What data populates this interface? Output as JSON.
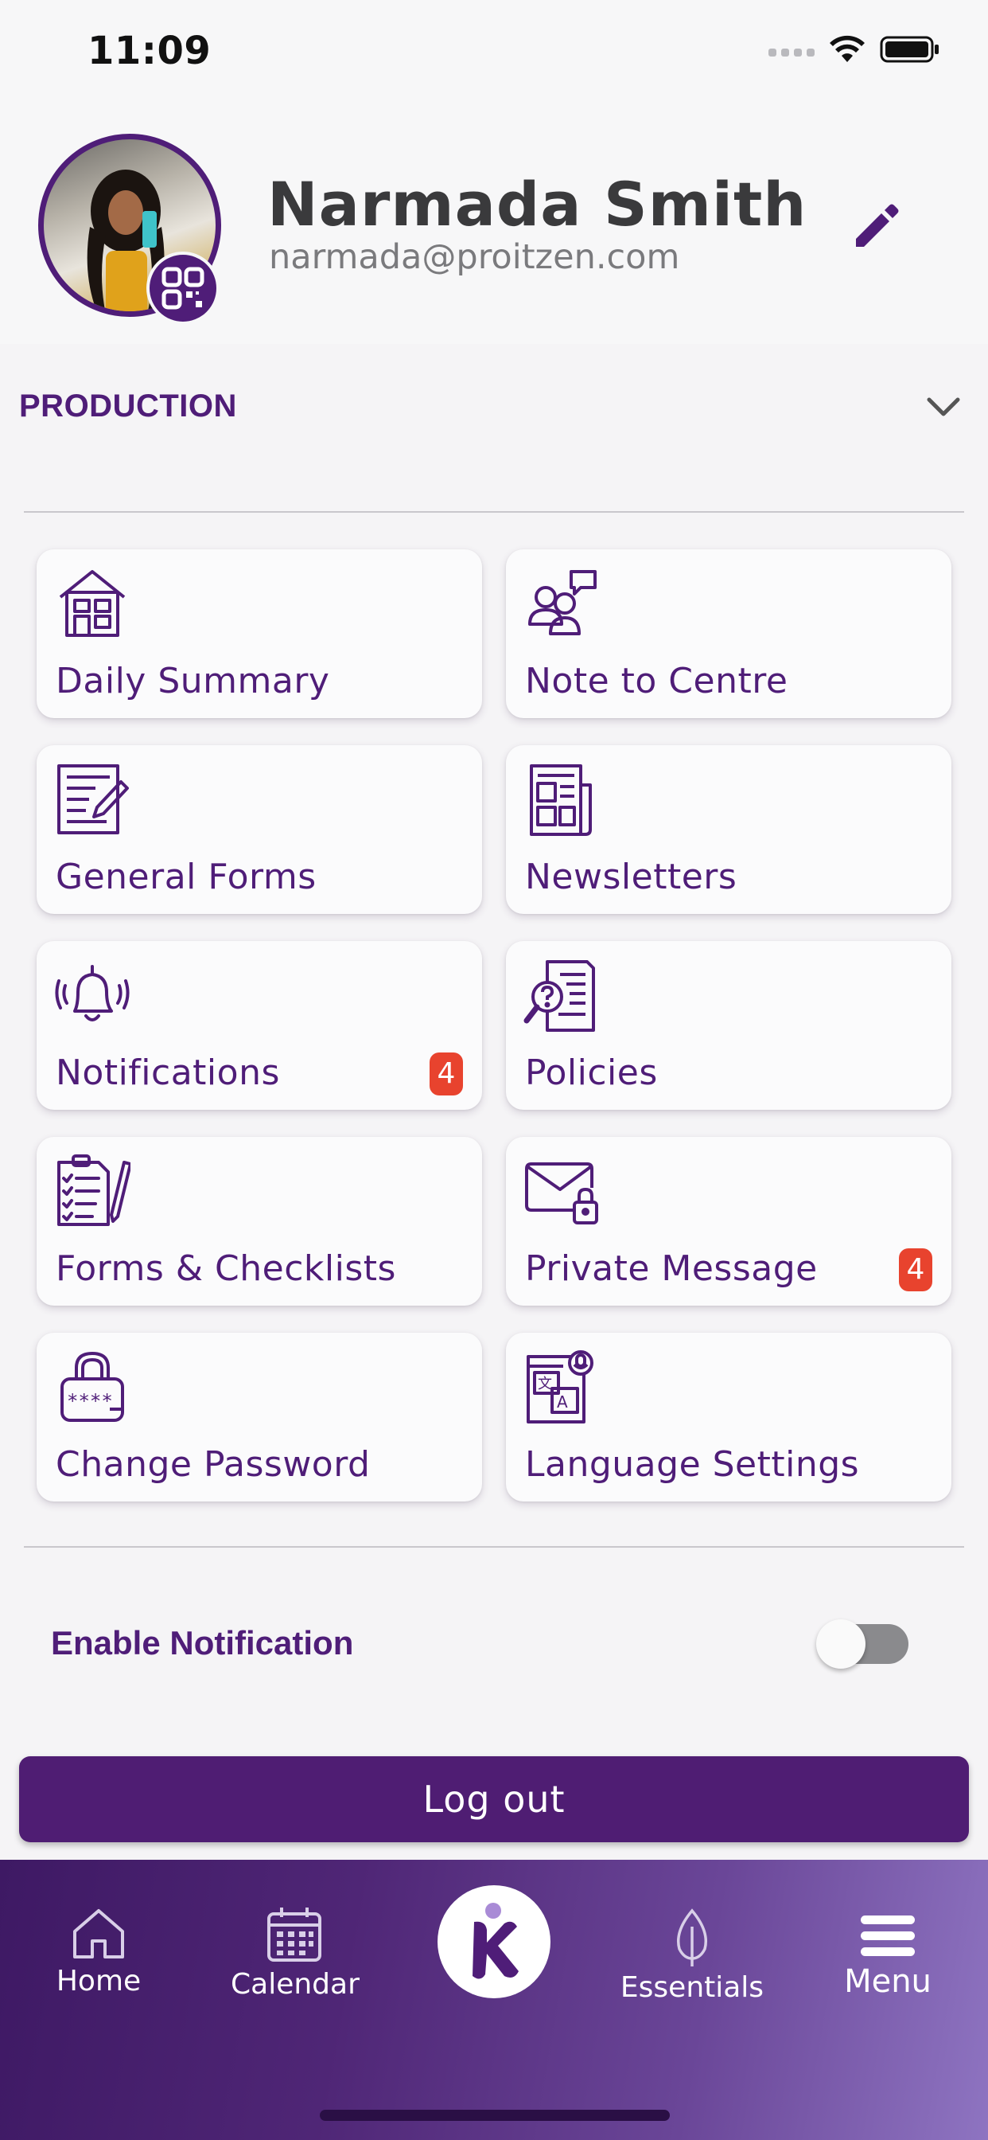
{
  "status_bar": {
    "time": "11:09"
  },
  "profile": {
    "name": "Narmada Smith",
    "email": "narmada@proitzen.com"
  },
  "section": {
    "label": "PRODUCTION"
  },
  "tiles": [
    {
      "label": "Daily Summary",
      "icon": "house-icon"
    },
    {
      "label": "Note to Centre",
      "icon": "people-message-icon"
    },
    {
      "label": "General Forms",
      "icon": "form-pencil-icon"
    },
    {
      "label": "Newsletters",
      "icon": "newspaper-icon"
    },
    {
      "label": "Notifications",
      "icon": "bell-ringing-icon",
      "badge": "4"
    },
    {
      "label": "Policies",
      "icon": "document-search-icon"
    },
    {
      "label": "Forms & Checklists",
      "icon": "checklist-icon"
    },
    {
      "label": "Private Message",
      "icon": "envelope-lock-icon",
      "badge": "4"
    },
    {
      "label": "Change Password",
      "icon": "padlock-password-icon"
    },
    {
      "label": "Language Settings",
      "icon": "translate-icon"
    }
  ],
  "settings": {
    "enable_notification_label": "Enable Notification",
    "enable_notification_on": false
  },
  "logout": {
    "label": "Log out"
  },
  "tab_bar": {
    "items": [
      {
        "label": "Home",
        "icon": "home-icon"
      },
      {
        "label": "Calendar",
        "icon": "calendar-icon"
      },
      {
        "label": "",
        "icon": "app-logo-icon"
      },
      {
        "label": "Essentials",
        "icon": "leaf-icon"
      },
      {
        "label": "Menu",
        "icon": "hamburger-icon"
      }
    ]
  },
  "colors": {
    "brand_purple": "#4f1d78",
    "badge_red": "#e8432e",
    "toggle_off": "#8a8a8d"
  }
}
